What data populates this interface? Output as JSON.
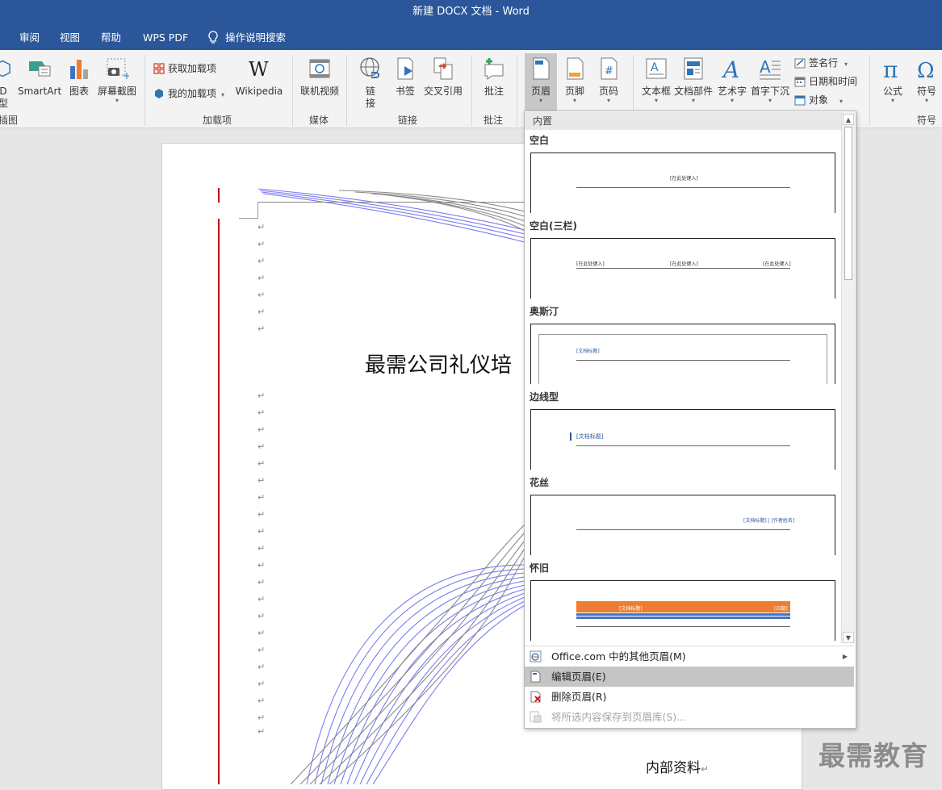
{
  "window": {
    "title": "新建 DOCX 文档  -  Word"
  },
  "menu": {
    "items": [
      "审阅",
      "视图",
      "帮助",
      "WPS PDF"
    ],
    "tell_me": "操作说明搜索"
  },
  "ribbon": {
    "illustrations": {
      "model3d_1": "D",
      "model3d_2": "型",
      "smartart": "SmartArt",
      "chart": "图表",
      "screenshot": "屏幕截图",
      "group": "插图"
    },
    "addins": {
      "get_addins": "获取加载项",
      "my_addins": "我的加载项",
      "wikipedia": "Wikipedia",
      "group": "加载项"
    },
    "media": {
      "online_video": "联机视频",
      "group": "媒体"
    },
    "links": {
      "link_1": "链",
      "link_2": "接",
      "bookmark": "书签",
      "cross_ref": "交叉引用",
      "group": "链接"
    },
    "comments": {
      "comment": "批注",
      "group": "批注"
    },
    "header_footer": {
      "header": "页眉",
      "footer": "页脚",
      "page_number": "页码"
    },
    "text": {
      "text_box": "文本框",
      "quick_parts": "文档部件",
      "wordart": "艺术字",
      "drop_cap": "首字下沉",
      "signature_line": "签名行",
      "date_time": "日期和时间",
      "object": "对象"
    },
    "symbols": {
      "equation": "公式",
      "symbol": "符号",
      "group": "符号"
    }
  },
  "document": {
    "title": "最需公司礼仪培",
    "footer": "内部资料",
    "watermark": "最需教育"
  },
  "dropdown": {
    "section": "内置",
    "gallery": [
      {
        "name": "空白",
        "placeholders": [
          "[在此处键入]"
        ]
      },
      {
        "name": "空白(三栏)",
        "placeholders": [
          "[在此处键入]",
          "[在此处键入]",
          "[在此处键入]"
        ]
      },
      {
        "name": "奥斯汀",
        "placeholders": [
          "[文档标题]"
        ]
      },
      {
        "name": "边线型",
        "placeholders": [
          "[文档标题]"
        ]
      },
      {
        "name": "花丝",
        "placeholders": [
          "[文档标题] | [作者姓名]"
        ]
      },
      {
        "name": "怀旧",
        "placeholders": [
          "[文档标题]",
          "[日期]"
        ]
      }
    ],
    "commands": [
      {
        "label": "Office.com 中的其他页眉(M)",
        "state": "normal"
      },
      {
        "label": "编辑页眉(E)",
        "state": "hover"
      },
      {
        "label": "删除页眉(R)",
        "state": "normal"
      },
      {
        "label": "将所选内容保存到页眉库(S)...",
        "state": "disabled"
      }
    ]
  },
  "colors": {
    "accent": "#2b579a",
    "ribbon_bg": "#f3f3f3",
    "margin_line": "#c00000",
    "curve_blue": "#7b7bf0",
    "curve_gray": "#8a8a8a",
    "retro_orange": "#ed7d31",
    "retro_blue": "#4472c4"
  },
  "icons": [
    "3d-model-icon",
    "smartart-icon",
    "chart-icon",
    "screenshot-icon",
    "store-icon",
    "my-addins-icon",
    "wikipedia-icon",
    "video-icon",
    "link-icon",
    "bookmark-icon",
    "cross-reference-icon",
    "comment-icon",
    "header-icon",
    "footer-icon",
    "page-number-icon",
    "textbox-icon",
    "quick-parts-icon",
    "wordart-icon",
    "dropcap-icon",
    "signature-icon",
    "datetime-icon",
    "object-icon",
    "equation-icon",
    "omega-icon",
    "lightbulb-icon",
    "office-com-icon",
    "edit-header-icon",
    "delete-header-icon",
    "save-gallery-icon"
  ]
}
